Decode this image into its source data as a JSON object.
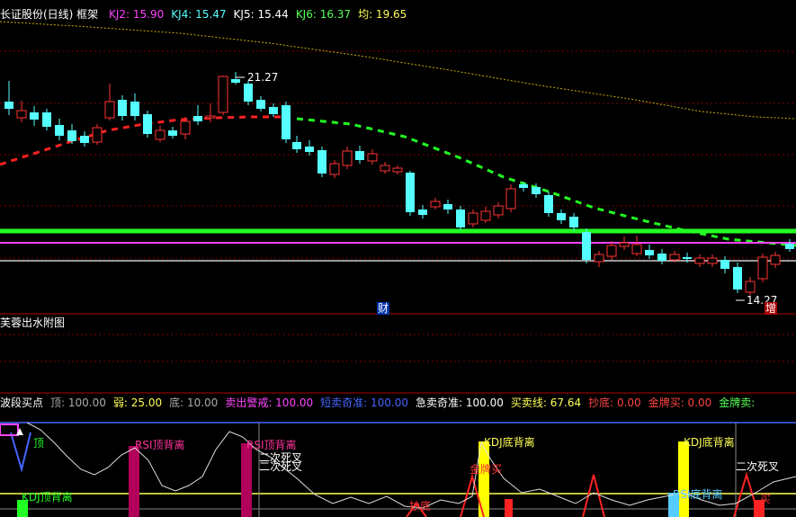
{
  "header": {
    "title": "长证股份(日线) 框架",
    "items": [
      {
        "text": "KJ2: 15.90",
        "color": "#ff44ff"
      },
      {
        "text": "KJ4: 15.47",
        "color": "#55ffff"
      },
      {
        "text": "KJ5: 15.44",
        "color": "#ffffff"
      },
      {
        "text": "KJ6: 16.37",
        "color": "#55ff55"
      },
      {
        "text": "均: 19.65",
        "color": "#ffff55"
      }
    ]
  },
  "price_annotations": {
    "high": "21.27",
    "low": "14.27",
    "finance_marker": "财",
    "increase_marker": "增"
  },
  "sub_panel_1": {
    "title": "芙蓉出水附图"
  },
  "sub_panel_2": {
    "items": [
      {
        "text": "波段买点",
        "color": "#ffffff"
      },
      {
        "text": "顶: 100.00",
        "color": "#aaaaaa"
      },
      {
        "text": "弱: 25.00",
        "color": "#ffff55"
      },
      {
        "text": "底: 10.00",
        "color": "#aaaaaa"
      },
      {
        "text": "卖出警戒: 100.00",
        "color": "#ff44ff"
      },
      {
        "text": "短卖奇准: 100.00",
        "color": "#4466ff"
      },
      {
        "text": "急卖奇准: 100.00",
        "color": "#ffffff"
      },
      {
        "text": "买卖线: 67.64",
        "color": "#ffff55"
      },
      {
        "text": "抄底: 0.00",
        "color": "#ff4444"
      },
      {
        "text": "金牌买: 0.00",
        "color": "#ff4444"
      },
      {
        "text": "金牌卖: ",
        "color": "#55ff55"
      }
    ],
    "signals": {
      "top": "顶",
      "rsi_top_div_1": "RSI顶背离",
      "rsi_top_div_2": "RSI顶背离",
      "kdj_top_div": "KDJ顶背离",
      "second_death_cross_1": "二次死叉",
      "second_death_cross_2": "二次死叉",
      "second_death_cross_3": "二次死叉",
      "kdj_bottom_div_1": "KDJ底背离",
      "kdj_bottom_div_2": "KDJ底背离",
      "gold_buy": "金牌买",
      "rsi_bottom_div": "RSI底背离",
      "bottom_fish": "抄底",
      "buy_short": "买"
    }
  },
  "colors": {
    "up": "#ff3333",
    "down": "#55ffff",
    "grid": "#800000",
    "ma_red": "#ff2222",
    "ma_green": "#22ff22",
    "ma_yellow": "#c8b000"
  }
}
